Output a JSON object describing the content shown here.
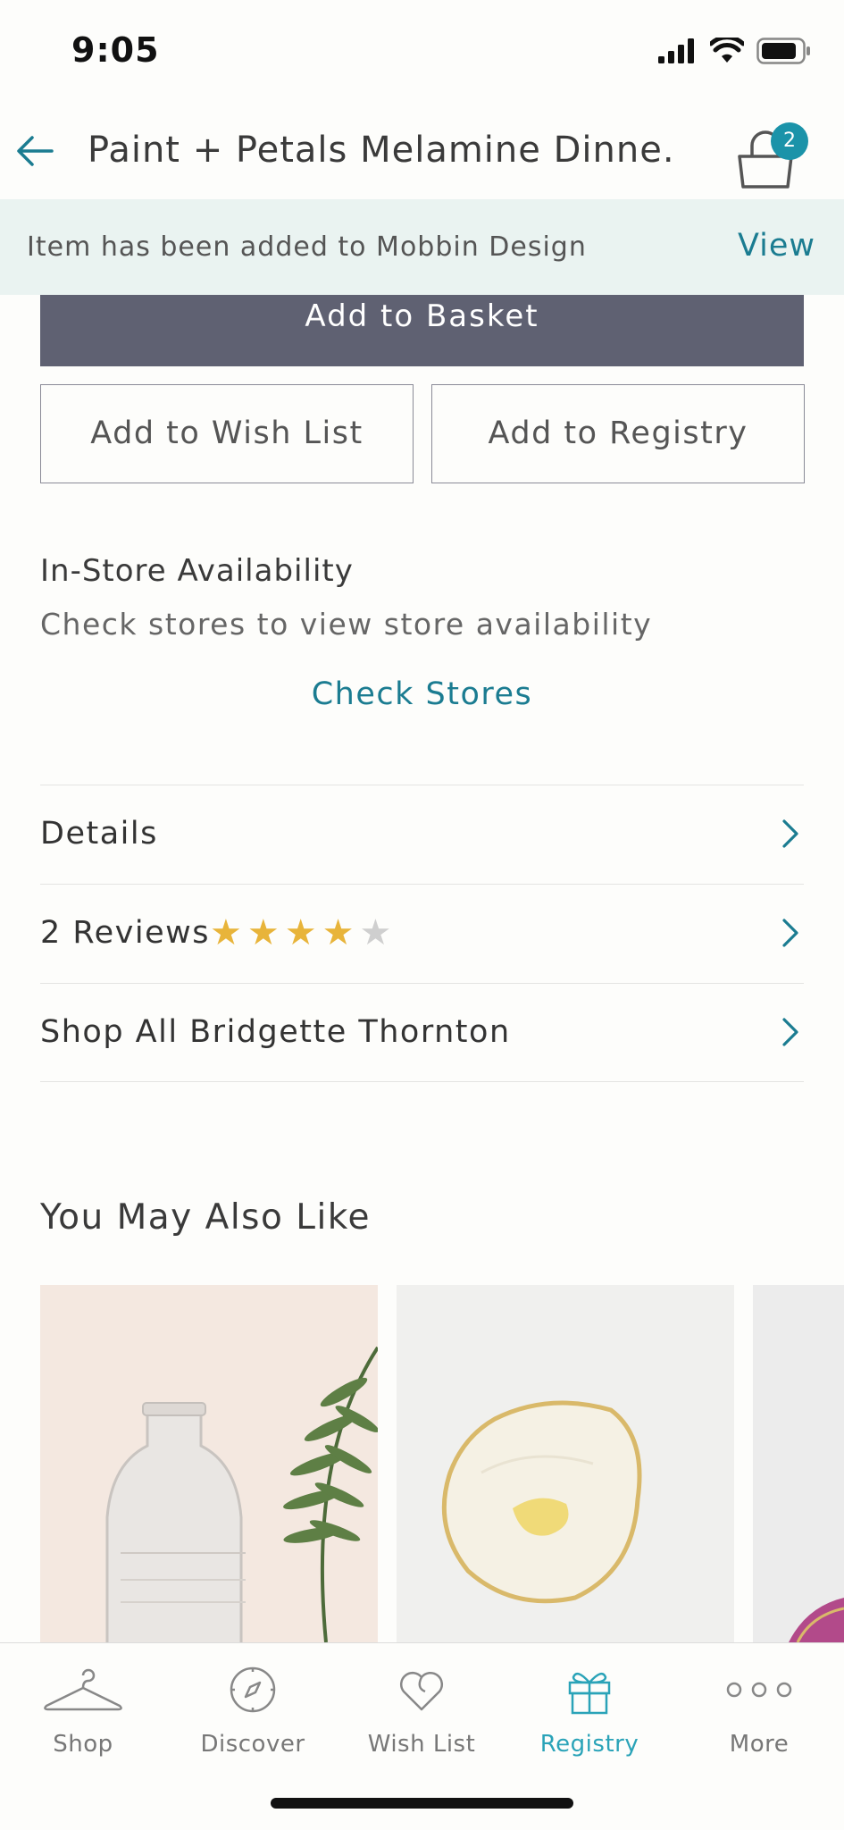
{
  "status": {
    "time": "9:05"
  },
  "nav": {
    "title": "Paint + Petals Melamine Dinne...",
    "cart_count": "2"
  },
  "toast": {
    "message": "Item has been added to Mobbin Design",
    "action": "View"
  },
  "actions": {
    "add_to_basket": "Add to Basket",
    "add_to_wish_list": "Add to Wish List",
    "add_to_registry": "Add to Registry"
  },
  "availability": {
    "title": "In-Store Availability",
    "subtitle": "Check stores to view store availability",
    "link": "Check Stores"
  },
  "rows": [
    {
      "label": "Details"
    },
    {
      "label": "2 Reviews",
      "rating": 4,
      "max_rating": 5
    },
    {
      "label": "Shop All Bridgette Thornton"
    }
  ],
  "recommendations": {
    "title": "You May Also Like"
  },
  "tabs": [
    {
      "label": "Shop",
      "icon": "hanger-icon"
    },
    {
      "label": "Discover",
      "icon": "compass-icon"
    },
    {
      "label": "Wish List",
      "icon": "heart-icon"
    },
    {
      "label": "Registry",
      "icon": "gift-icon",
      "active": true
    },
    {
      "label": "More",
      "icon": "more-icon"
    }
  ],
  "colors": {
    "accent": "#1b7c91",
    "active_tab": "#2aa3b8",
    "primary_button": "#5f6172",
    "star": "#e8b43a"
  }
}
